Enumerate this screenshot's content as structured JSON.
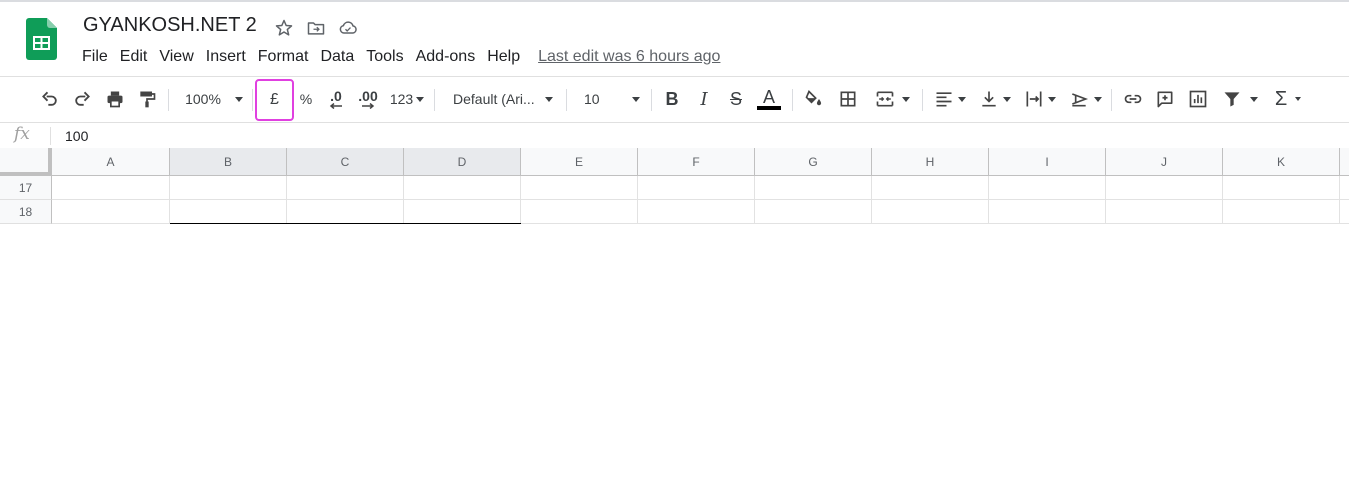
{
  "doc": {
    "title": "GYANKOSH.NET 2",
    "icons": [
      "star-icon",
      "move-folder-icon",
      "cloud-saved-icon"
    ]
  },
  "menu": {
    "items": [
      "File",
      "Edit",
      "View",
      "Insert",
      "Format",
      "Data",
      "Tools",
      "Add-ons",
      "Help"
    ],
    "last_edit": "Last edit was 6 hours ago"
  },
  "toolbar": {
    "zoom": "100%",
    "currency": "£",
    "percent": "%",
    "decrease_decimal": ".0",
    "increase_decimal": ".00",
    "more_formats": "123",
    "font": "Default (Ari...",
    "font_size": "10",
    "bold": "B",
    "italic": "I",
    "strikethrough": "S",
    "text_color_label": "A",
    "highlight_color": "#e040e0",
    "sigma": "Σ"
  },
  "formula_bar": {
    "fx": "fx",
    "value": "100"
  },
  "grid": {
    "columns": [
      "A",
      "B",
      "C",
      "D",
      "E",
      "F",
      "G",
      "H",
      "I",
      "J",
      "K"
    ],
    "selected_columns": [
      "B",
      "C",
      "D"
    ],
    "rows": [
      "17",
      "18"
    ]
  }
}
